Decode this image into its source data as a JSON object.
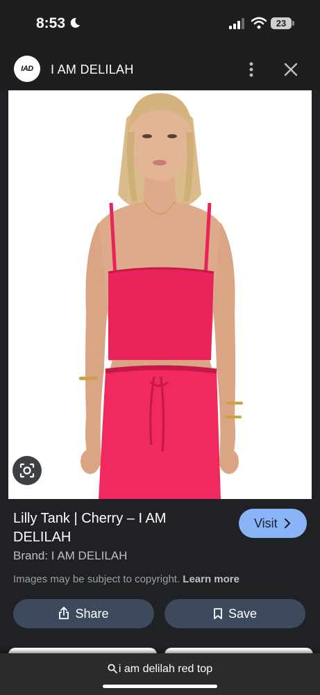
{
  "status": {
    "time": "8:53",
    "battery": "23"
  },
  "header": {
    "logo_text": "IAD",
    "title": "I AM DELILAH"
  },
  "product": {
    "title": "Lilly Tank | Cherry – I AM DELILAH",
    "visit_label": "Visit",
    "brand": "Brand: I AM DELILAH",
    "copyright": "Images may be subject to copyright.",
    "learn_more": "Learn more"
  },
  "actions": {
    "share_label": "Share",
    "save_label": "Save"
  },
  "search": {
    "query": "i am delilah red top"
  },
  "icons": {
    "moon": "moon-icon",
    "signal": "signal-icon",
    "wifi": "wifi-icon",
    "menu": "more-vert-icon",
    "close": "close-icon",
    "lens": "lens-icon",
    "share": "share-icon",
    "save": "bookmark-icon",
    "search": "search-icon"
  },
  "colors": {
    "accent": "#8ab4f8",
    "garment": "#e8245a",
    "button_bg": "#3c4a5c"
  }
}
